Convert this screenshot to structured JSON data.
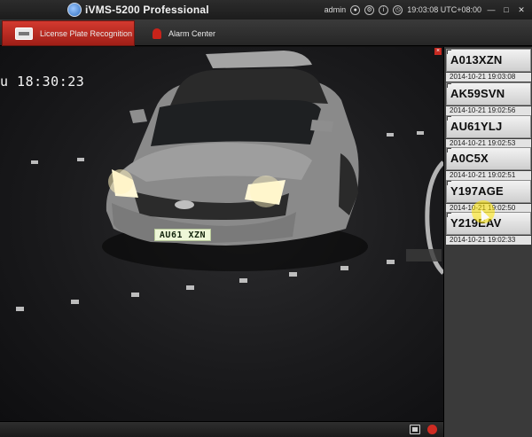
{
  "app": {
    "title": "iVMS-5200 Professional",
    "user": "admin",
    "clock": "19:03:08 UTC+08:00"
  },
  "tabs": [
    {
      "label": "License Plate Recognition",
      "active": true
    },
    {
      "label": "Alarm Center",
      "active": false
    }
  ],
  "video": {
    "osd_time": "u 18:30:23",
    "car_plate": "AU61 XZN"
  },
  "recognitions": [
    {
      "plate": "A013XZN",
      "time": "2014-10-21 19:03:08"
    },
    {
      "plate": "AK59SVN",
      "time": "2014-10-21 19:02:56"
    },
    {
      "plate": "AU61YLJ",
      "time": "2014-10-21 19:02:53"
    },
    {
      "plate": "A0C5X",
      "time": "2014-10-21 19:02:51"
    },
    {
      "plate": "Y197AGE",
      "time": "2014-10-21 19:02:50"
    },
    {
      "plate": "Y219EAV",
      "time": "2014-10-21 19:02:33"
    }
  ],
  "colors": {
    "accent_red": "#c62a22",
    "plate_bg": "#eef7d8"
  }
}
